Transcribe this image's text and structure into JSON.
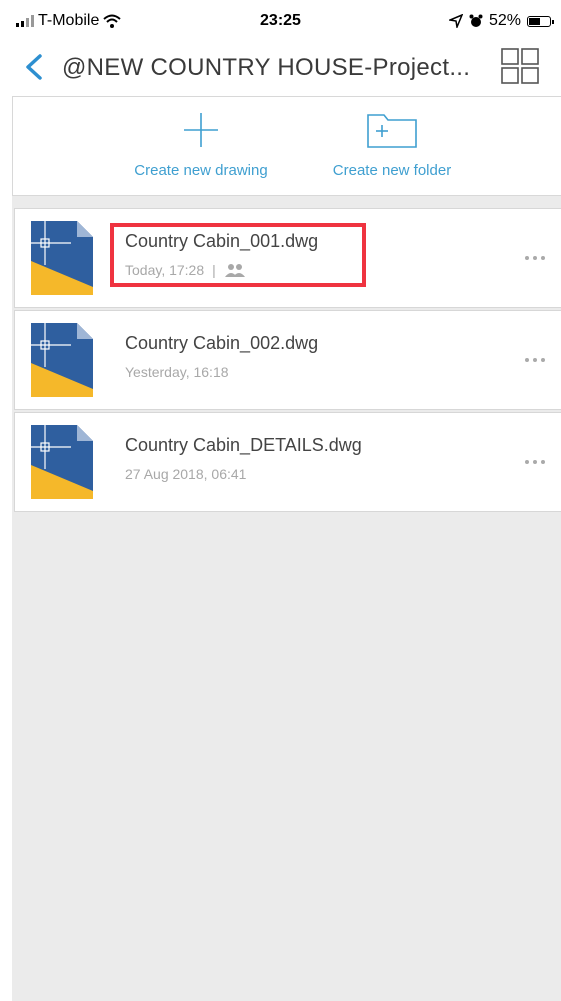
{
  "status_bar": {
    "carrier": "T-Mobile",
    "time": "23:25",
    "battery": "52%",
    "battery_level": 0.52
  },
  "nav": {
    "title": "@NEW COUNTRY HOUSE-Project..."
  },
  "actions": {
    "create_drawing": "Create new drawing",
    "create_folder": "Create new folder"
  },
  "files": [
    {
      "name": "Country Cabin_001.dwg",
      "meta": "Today, 17:28",
      "separator": "|",
      "shared": true,
      "highlighted": true
    },
    {
      "name": "Country Cabin_002.dwg",
      "meta": "Yesterday, 16:18",
      "shared": false,
      "highlighted": false
    },
    {
      "name": "Country Cabin_DETAILS.dwg",
      "meta": "27 Aug 2018, 06:41",
      "shared": false,
      "highlighted": false
    }
  ],
  "colors": {
    "accent": "#3f9fd0",
    "highlight": "#ef3340",
    "thumb_blue": "#2f5f9f",
    "thumb_yellow": "#f5b82a"
  },
  "icons": {
    "back": "chevron-left-icon",
    "grid": "grid-view-icon",
    "plus": "plus-icon",
    "folder": "folder-plus-icon",
    "shared": "people-icon",
    "more": "more-dots-icon",
    "file": "dwg-file-icon"
  }
}
